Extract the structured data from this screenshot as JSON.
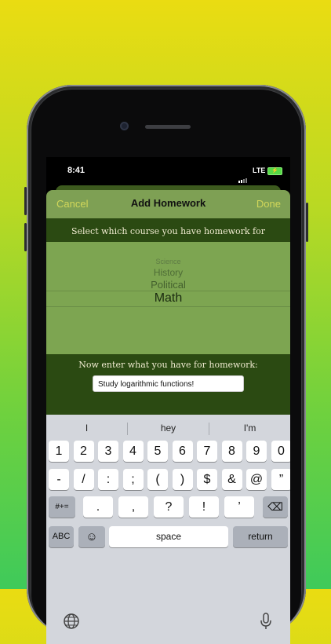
{
  "status": {
    "time": "8:41",
    "network": "LTE"
  },
  "nav": {
    "cancel": "Cancel",
    "title": "Add Homework",
    "done": "Done"
  },
  "course": {
    "prompt": "Select which course you have homework for",
    "options": [
      "Science",
      "History",
      "Political",
      "Math"
    ],
    "selected": "Math"
  },
  "homework": {
    "prompt": "Now enter what you have for homework:",
    "value": "Study logarithmic functions!"
  },
  "keyboard": {
    "suggestions": [
      "I",
      "hey",
      "I'm"
    ],
    "row1": [
      "1",
      "2",
      "3",
      "4",
      "5",
      "6",
      "7",
      "8",
      "9",
      "0"
    ],
    "row2": [
      "-",
      "/",
      ":",
      ";",
      "(",
      ")",
      "$",
      "&",
      "@",
      "”"
    ],
    "row3": {
      "toggle": "#+=",
      "keys": [
        ".",
        ",",
        "?",
        "!",
        "’"
      ]
    },
    "abc": "ABC",
    "space": "space",
    "return": "return"
  },
  "icons": [
    "camera-icon",
    "speaker-grille",
    "signal-icon",
    "battery-icon",
    "backspace-icon",
    "emoji-icon",
    "globe-icon",
    "microphone-icon"
  ]
}
